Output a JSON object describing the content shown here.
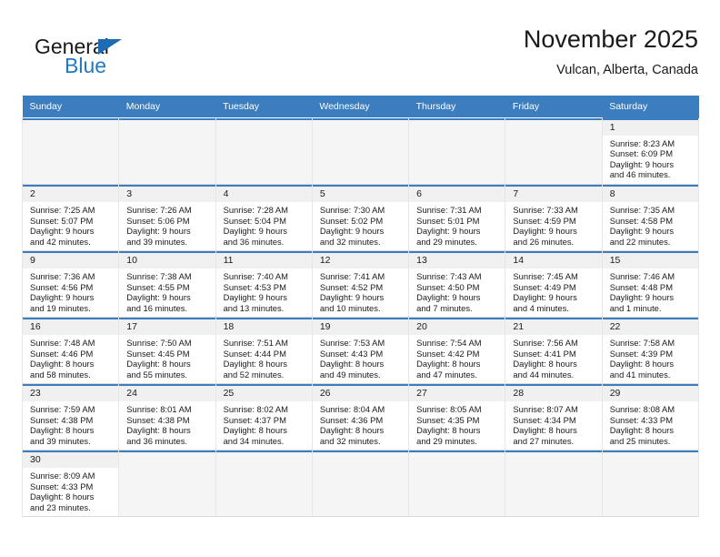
{
  "brand": {
    "name_top": "General",
    "name_bottom": "Blue",
    "triangle_icon": "logo-triangle-icon",
    "color_blue": "#2079c4",
    "color_dark": "#1a1a1a"
  },
  "header": {
    "title": "November 2025",
    "subtitle": "Vulcan, Alberta, Canada"
  },
  "calendar": {
    "accent_color": "#3b7dbf",
    "weekdays": [
      "Sunday",
      "Monday",
      "Tuesday",
      "Wednesday",
      "Thursday",
      "Friday",
      "Saturday"
    ],
    "weeks": [
      [
        {
          "empty": true
        },
        {
          "empty": true
        },
        {
          "empty": true
        },
        {
          "empty": true
        },
        {
          "empty": true
        },
        {
          "empty": true
        },
        {
          "day": "1",
          "sunrise": "Sunrise: 8:23 AM",
          "sunset": "Sunset: 6:09 PM",
          "daylight_line1": "Daylight: 9 hours",
          "daylight_line2": "and 46 minutes."
        }
      ],
      [
        {
          "day": "2",
          "sunrise": "Sunrise: 7:25 AM",
          "sunset": "Sunset: 5:07 PM",
          "daylight_line1": "Daylight: 9 hours",
          "daylight_line2": "and 42 minutes."
        },
        {
          "day": "3",
          "sunrise": "Sunrise: 7:26 AM",
          "sunset": "Sunset: 5:06 PM",
          "daylight_line1": "Daylight: 9 hours",
          "daylight_line2": "and 39 minutes."
        },
        {
          "day": "4",
          "sunrise": "Sunrise: 7:28 AM",
          "sunset": "Sunset: 5:04 PM",
          "daylight_line1": "Daylight: 9 hours",
          "daylight_line2": "and 36 minutes."
        },
        {
          "day": "5",
          "sunrise": "Sunrise: 7:30 AM",
          "sunset": "Sunset: 5:02 PM",
          "daylight_line1": "Daylight: 9 hours",
          "daylight_line2": "and 32 minutes."
        },
        {
          "day": "6",
          "sunrise": "Sunrise: 7:31 AM",
          "sunset": "Sunset: 5:01 PM",
          "daylight_line1": "Daylight: 9 hours",
          "daylight_line2": "and 29 minutes."
        },
        {
          "day": "7",
          "sunrise": "Sunrise: 7:33 AM",
          "sunset": "Sunset: 4:59 PM",
          "daylight_line1": "Daylight: 9 hours",
          "daylight_line2": "and 26 minutes."
        },
        {
          "day": "8",
          "sunrise": "Sunrise: 7:35 AM",
          "sunset": "Sunset: 4:58 PM",
          "daylight_line1": "Daylight: 9 hours",
          "daylight_line2": "and 22 minutes."
        }
      ],
      [
        {
          "day": "9",
          "sunrise": "Sunrise: 7:36 AM",
          "sunset": "Sunset: 4:56 PM",
          "daylight_line1": "Daylight: 9 hours",
          "daylight_line2": "and 19 minutes."
        },
        {
          "day": "10",
          "sunrise": "Sunrise: 7:38 AM",
          "sunset": "Sunset: 4:55 PM",
          "daylight_line1": "Daylight: 9 hours",
          "daylight_line2": "and 16 minutes."
        },
        {
          "day": "11",
          "sunrise": "Sunrise: 7:40 AM",
          "sunset": "Sunset: 4:53 PM",
          "daylight_line1": "Daylight: 9 hours",
          "daylight_line2": "and 13 minutes."
        },
        {
          "day": "12",
          "sunrise": "Sunrise: 7:41 AM",
          "sunset": "Sunset: 4:52 PM",
          "daylight_line1": "Daylight: 9 hours",
          "daylight_line2": "and 10 minutes."
        },
        {
          "day": "13",
          "sunrise": "Sunrise: 7:43 AM",
          "sunset": "Sunset: 4:50 PM",
          "daylight_line1": "Daylight: 9 hours",
          "daylight_line2": "and 7 minutes."
        },
        {
          "day": "14",
          "sunrise": "Sunrise: 7:45 AM",
          "sunset": "Sunset: 4:49 PM",
          "daylight_line1": "Daylight: 9 hours",
          "daylight_line2": "and 4 minutes."
        },
        {
          "day": "15",
          "sunrise": "Sunrise: 7:46 AM",
          "sunset": "Sunset: 4:48 PM",
          "daylight_line1": "Daylight: 9 hours",
          "daylight_line2": "and 1 minute."
        }
      ],
      [
        {
          "day": "16",
          "sunrise": "Sunrise: 7:48 AM",
          "sunset": "Sunset: 4:46 PM",
          "daylight_line1": "Daylight: 8 hours",
          "daylight_line2": "and 58 minutes."
        },
        {
          "day": "17",
          "sunrise": "Sunrise: 7:50 AM",
          "sunset": "Sunset: 4:45 PM",
          "daylight_line1": "Daylight: 8 hours",
          "daylight_line2": "and 55 minutes."
        },
        {
          "day": "18",
          "sunrise": "Sunrise: 7:51 AM",
          "sunset": "Sunset: 4:44 PM",
          "daylight_line1": "Daylight: 8 hours",
          "daylight_line2": "and 52 minutes."
        },
        {
          "day": "19",
          "sunrise": "Sunrise: 7:53 AM",
          "sunset": "Sunset: 4:43 PM",
          "daylight_line1": "Daylight: 8 hours",
          "daylight_line2": "and 49 minutes."
        },
        {
          "day": "20",
          "sunrise": "Sunrise: 7:54 AM",
          "sunset": "Sunset: 4:42 PM",
          "daylight_line1": "Daylight: 8 hours",
          "daylight_line2": "and 47 minutes."
        },
        {
          "day": "21",
          "sunrise": "Sunrise: 7:56 AM",
          "sunset": "Sunset: 4:41 PM",
          "daylight_line1": "Daylight: 8 hours",
          "daylight_line2": "and 44 minutes."
        },
        {
          "day": "22",
          "sunrise": "Sunrise: 7:58 AM",
          "sunset": "Sunset: 4:39 PM",
          "daylight_line1": "Daylight: 8 hours",
          "daylight_line2": "and 41 minutes."
        }
      ],
      [
        {
          "day": "23",
          "sunrise": "Sunrise: 7:59 AM",
          "sunset": "Sunset: 4:38 PM",
          "daylight_line1": "Daylight: 8 hours",
          "daylight_line2": "and 39 minutes."
        },
        {
          "day": "24",
          "sunrise": "Sunrise: 8:01 AM",
          "sunset": "Sunset: 4:38 PM",
          "daylight_line1": "Daylight: 8 hours",
          "daylight_line2": "and 36 minutes."
        },
        {
          "day": "25",
          "sunrise": "Sunrise: 8:02 AM",
          "sunset": "Sunset: 4:37 PM",
          "daylight_line1": "Daylight: 8 hours",
          "daylight_line2": "and 34 minutes."
        },
        {
          "day": "26",
          "sunrise": "Sunrise: 8:04 AM",
          "sunset": "Sunset: 4:36 PM",
          "daylight_line1": "Daylight: 8 hours",
          "daylight_line2": "and 32 minutes."
        },
        {
          "day": "27",
          "sunrise": "Sunrise: 8:05 AM",
          "sunset": "Sunset: 4:35 PM",
          "daylight_line1": "Daylight: 8 hours",
          "daylight_line2": "and 29 minutes."
        },
        {
          "day": "28",
          "sunrise": "Sunrise: 8:07 AM",
          "sunset": "Sunset: 4:34 PM",
          "daylight_line1": "Daylight: 8 hours",
          "daylight_line2": "and 27 minutes."
        },
        {
          "day": "29",
          "sunrise": "Sunrise: 8:08 AM",
          "sunset": "Sunset: 4:33 PM",
          "daylight_line1": "Daylight: 8 hours",
          "daylight_line2": "and 25 minutes."
        }
      ],
      [
        {
          "day": "30",
          "sunrise": "Sunrise: 8:09 AM",
          "sunset": "Sunset: 4:33 PM",
          "daylight_line1": "Daylight: 8 hours",
          "daylight_line2": "and 23 minutes."
        },
        {
          "empty": true
        },
        {
          "empty": true
        },
        {
          "empty": true
        },
        {
          "empty": true
        },
        {
          "empty": true
        },
        {
          "empty": true
        }
      ]
    ]
  }
}
